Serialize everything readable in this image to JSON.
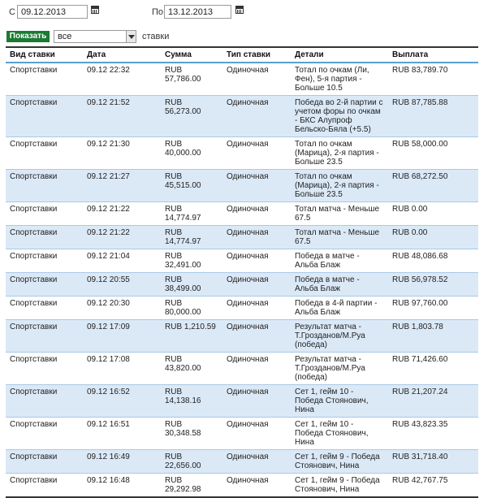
{
  "filters": {
    "from_label": "С",
    "from_value": "09.12.2013",
    "to_label": "По",
    "to_value": "13.12.2013",
    "show_button": "Показать",
    "type_select": "все",
    "type_suffix": "ставки"
  },
  "table": {
    "headers": [
      "Вид ставки",
      "Дата",
      "Сумма",
      "Тип ставки",
      "Детали",
      "Выплата"
    ],
    "rows": [
      [
        "Спортставки",
        "09.12 22:32",
        "RUB 57,786.00",
        "Одиночная",
        "Тотал по очкам (Ли, Фен), 5-я партия - Больше 10.5",
        "RUB 83,789.70"
      ],
      [
        "Спортставки",
        "09.12 21:52",
        "RUB 56,273.00",
        "Одиночная",
        "Победа во 2-й партии с учетом форы по очкам - БКС Алупроф Бельско-Бяла (+5.5)",
        "RUB 87,785.88"
      ],
      [
        "Спортставки",
        "09.12 21:30",
        "RUB 40,000.00",
        "Одиночная",
        "Тотал по очкам (Марица), 2-я партия - Больше 23.5",
        "RUB 58,000.00"
      ],
      [
        "Спортставки",
        "09.12 21:27",
        "RUB 45,515.00",
        "Одиночная",
        "Тотал по очкам (Марица), 2-я партия - Больше 23.5",
        "RUB 68,272.50"
      ],
      [
        "Спортставки",
        "09.12 21:22",
        "RUB 14,774.97",
        "Одиночная",
        "Тотал матча - Меньше 67.5",
        "RUB 0.00"
      ],
      [
        "Спортставки",
        "09.12 21:22",
        "RUB 14,774.97",
        "Одиночная",
        "Тотал матча - Меньше 67.5",
        "RUB 0.00"
      ],
      [
        "Спортставки",
        "09.12 21:04",
        "RUB 32,491.00",
        "Одиночная",
        "Победа в матче - Альба Блаж",
        "RUB 48,086.68"
      ],
      [
        "Спортставки",
        "09.12 20:55",
        "RUB 38,499.00",
        "Одиночная",
        "Победа в матче - Альба Блаж",
        "RUB 56,978.52"
      ],
      [
        "Спортставки",
        "09.12 20:30",
        "RUB 80,000.00",
        "Одиночная",
        "Победа в 4-й партии - Альба Блаж",
        "RUB 97,760.00"
      ],
      [
        "Спортставки",
        "09.12 17:09",
        "RUB 1,210.59",
        "Одиночная",
        "Результат матча - Т.Грозданов/М.Руа (победа)",
        "RUB 1,803.78"
      ],
      [
        "Спортставки",
        "09.12 17:08",
        "RUB 43,820.00",
        "Одиночная",
        "Результат матча - Т.Грозданов/М.Руа (победа)",
        "RUB 71,426.60"
      ],
      [
        "Спортставки",
        "09.12 16:52",
        "RUB 14,138.16",
        "Одиночная",
        "Сет 1, гейм 10 - Победа Стоянович, Нина",
        "RUB 21,207.24"
      ],
      [
        "Спортставки",
        "09.12 16:51",
        "RUB 30,348.58",
        "Одиночная",
        "Сет 1, гейм 10 - Победа Стоянович, Нина",
        "RUB 43,823.35"
      ],
      [
        "Спортставки",
        "09.12 16:49",
        "RUB 22,656.00",
        "Одиночная",
        "Сет 1, гейм 9 - Победа Стоянович, Нина",
        "RUB 31,718.40"
      ],
      [
        "Спортставки",
        "09.12 16:48",
        "RUB 29,292.98",
        "Одиночная",
        "Сет 1, гейм 9 - Победа Стоянович, Нина",
        "RUB 42,767.75"
      ]
    ]
  }
}
